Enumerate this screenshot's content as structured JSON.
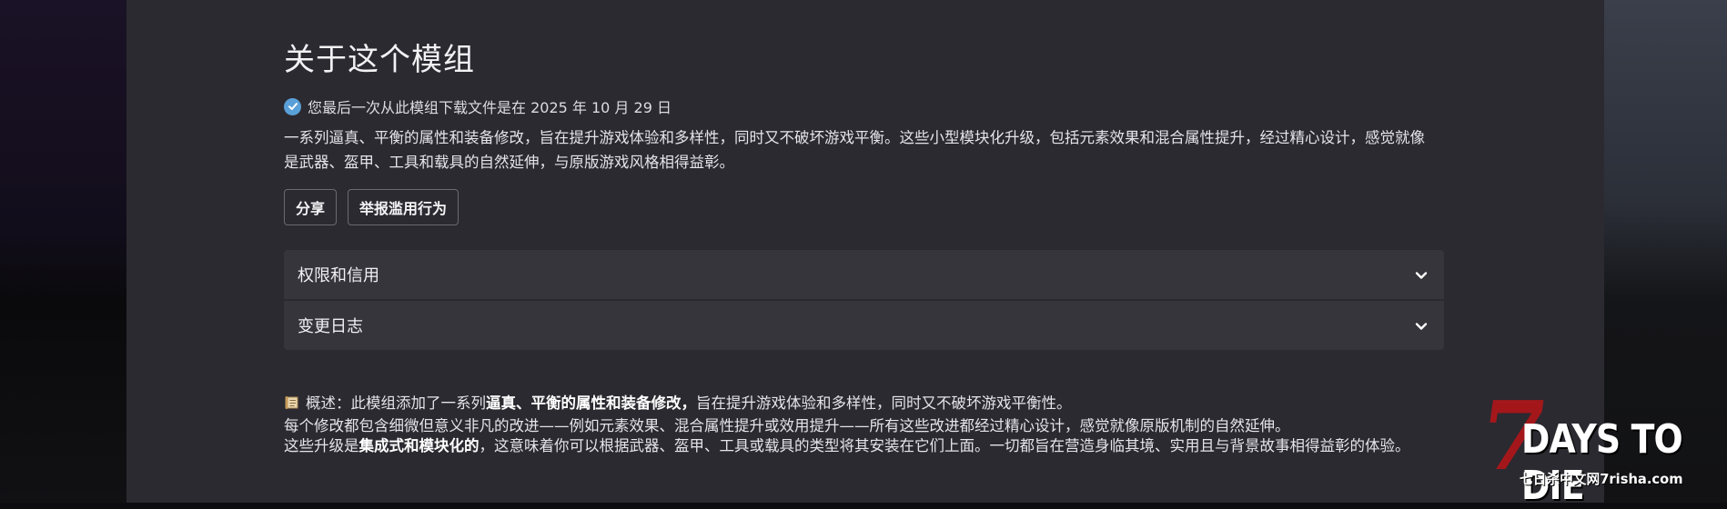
{
  "about": {
    "title": "关于这个模组",
    "download_notice": "您最后一次从此模组下载文件是在 2025 年 10 月 29 日",
    "description": "一系列逼真、平衡的属性和装备修改，旨在提升游戏体验和多样性，同时又不破坏游戏平衡。这些小型模块化升级，包括元素效果和混合属性提升，经过精心设计，感觉就像是武器、盔甲、工具和载具的自然延伸，与原版游戏风格相得益彰。"
  },
  "buttons": {
    "share": "分享",
    "report": "举报滥用行为"
  },
  "accordions": [
    {
      "label": "权限和信用"
    },
    {
      "label": "变更日志"
    }
  ],
  "overview": {
    "line1_prefix": "概述：此模组添加了一系列",
    "line1_bold": "逼真、平衡的属性和装备修改，",
    "line1_suffix": "旨在提升游戏体验和多样性，同时又不破坏游戏平衡性。",
    "line2": "每个修改都包含细微但意义非凡的改进——例如元素效果、混合属性提升或效用提升——所有这些改进都经过精心设计，感觉就像原版机制的自然延伸。",
    "line3_prefix": "这些升级是",
    "line3_bold": "集成式和模块化的",
    "line3_suffix": "，这意味着你可以根据武器、盔甲、工具或载具的类型将其安装在它们上面。一切都旨在营造身临其境、实用且与背景故事相得益彰的体验。"
  },
  "watermark": {
    "seven": "7",
    "title": "DAYS TO DIE",
    "subtitle": "七日杀中文网7risha.com"
  },
  "colors": {
    "panel": "#2b2a30",
    "accordion": "#36353c",
    "check": "#5aa0d8",
    "logo_red": "#a3171b"
  }
}
